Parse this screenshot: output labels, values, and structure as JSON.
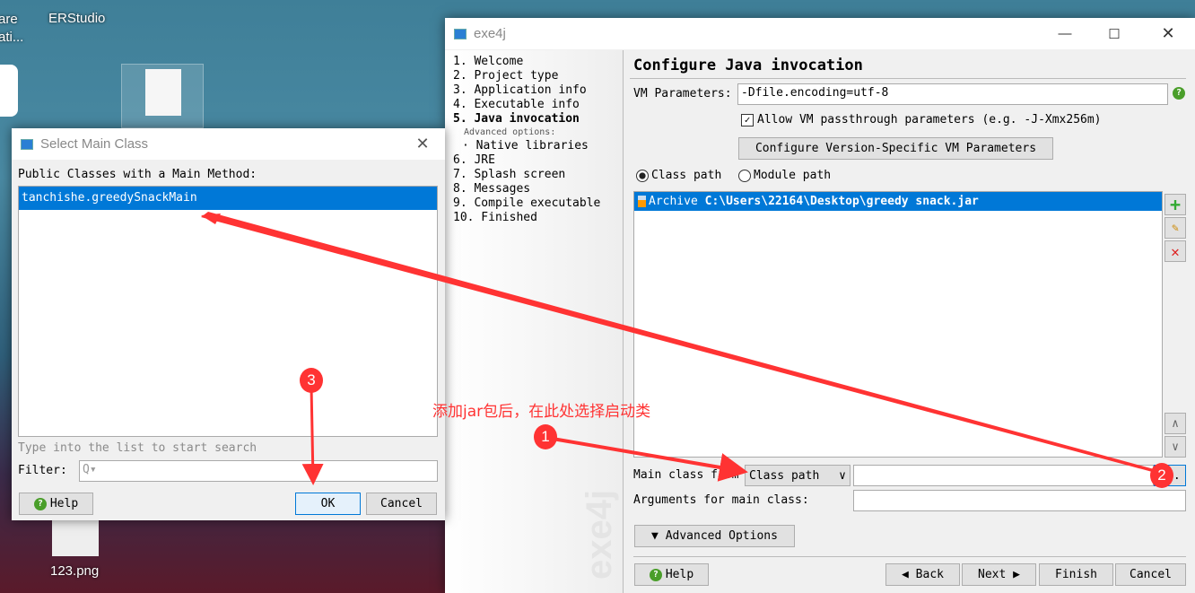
{
  "desktop": {
    "icons": [
      {
        "label": "ERStudio"
      },
      {
        "label": "are\nati..."
      },
      {
        "label": "123.png"
      }
    ]
  },
  "main_window": {
    "title": "exe4j",
    "steps": [
      "1. Welcome",
      "2. Project type",
      "3. Application info",
      "4. Executable info",
      "5. Java invocation",
      "Advanced options:",
      "· Native libraries",
      "6. JRE",
      "7. Splash screen",
      "8. Messages",
      "9. Compile executable",
      "10. Finished"
    ],
    "active_step": "5. Java invocation",
    "watermark": "exe4j",
    "heading": "Configure Java invocation",
    "vm_label": "VM Parameters:",
    "vm_value": "-Dfile.encoding=utf-8",
    "passthrough_label": "Allow VM passthrough parameters (e.g. -J-Xmx256m)",
    "passthrough_checked": true,
    "version_btn": "Configure Version-Specific VM Parameters",
    "radio_classpath": "Class path",
    "radio_modulepath": "Module path",
    "radio_selected": "Class path",
    "classpath_items": [
      {
        "prefix": "Archive",
        "path": "C:\\Users\\22164\\Desktop\\greedy snack.jar"
      }
    ],
    "main_class_label": "Main class from",
    "main_class_from": "Class path",
    "main_class_value": "",
    "browse_label": "...",
    "args_label": "Arguments for main class:",
    "args_value": "",
    "advanced_btn": "▼ Advanced Options",
    "help": "Help",
    "back": "◀ Back",
    "next": "Next ▶",
    "finish": "Finish",
    "cancel": "Cancel"
  },
  "dialog": {
    "title": "Select Main Class",
    "list_label": "Public Classes with a Main Method:",
    "classes": [
      "tanchishe.greedySnackMain"
    ],
    "search_hint": "Type into the list to start search",
    "filter_label": "Filter:",
    "filter_value": "",
    "help": "Help",
    "ok": "OK",
    "cancel": "Cancel"
  },
  "annotations": {
    "note": "添加jar包后，在此处选择启动类",
    "markers": [
      "1",
      "2",
      "3"
    ],
    "color": "#ff3333"
  }
}
